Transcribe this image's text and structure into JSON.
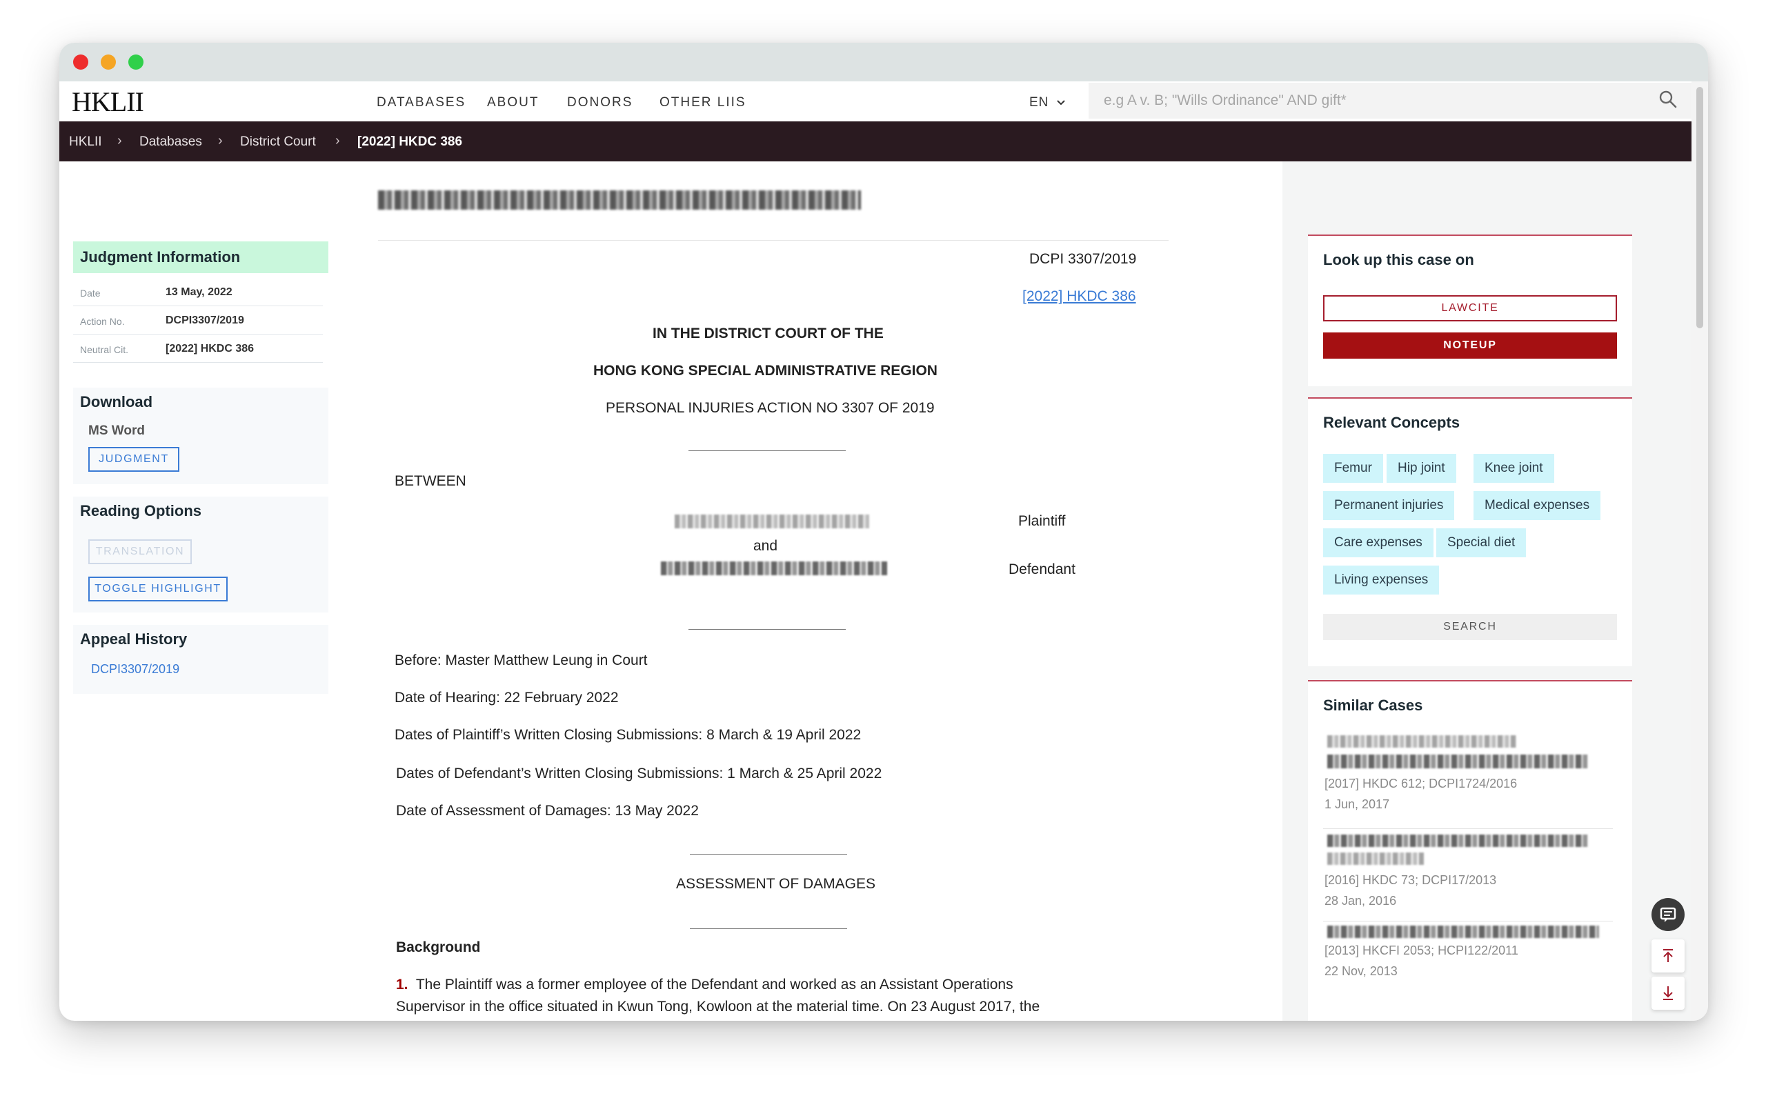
{
  "window": {
    "controls": [
      "close",
      "minimize",
      "zoom"
    ]
  },
  "nav": {
    "logo": "HKLII",
    "links": [
      "DATABASES",
      "ABOUT",
      "DONORS",
      "OTHER LIIS"
    ],
    "lang": "EN",
    "search_placeholder": "e.g A v. B; \"Wills Ordinance\" AND gift*",
    "search_icon": "search-icon"
  },
  "breadcrumb": [
    "HKLII",
    "Databases",
    "District Court",
    "[2022] HKDC 386"
  ],
  "breadcrumb_sep": "›",
  "sidebar": {
    "judgment_info": {
      "title": "Judgment Information",
      "rows": [
        {
          "key": "Date",
          "value": "13 May, 2022"
        },
        {
          "key": "Action No.",
          "value": "DCPI3307/2019"
        },
        {
          "key": "Neutral Cit.",
          "value": "[2022] HKDC 386"
        }
      ]
    },
    "download": {
      "title": "Download",
      "format": "MS Word",
      "button": "JUDGMENT"
    },
    "reading": {
      "title": "Reading Options",
      "translation": "TRANSLATION",
      "toggle": "TOGGLE HIGHLIGHT"
    },
    "appeal": {
      "title": "Appeal History",
      "link": "DCPI3307/2019"
    }
  },
  "doc": {
    "case_no": "DCPI 3307/2019",
    "citation_link": "[2022] HKDC 386",
    "court_line1": "IN THE DISTRICT COURT OF THE",
    "court_line2": "HONG KONG SPECIAL ADMINISTRATIVE REGION",
    "action_line": "PERSONAL INJURIES ACTION NO 3307 OF 2019",
    "between": "BETWEEN",
    "plaintiff_role": "Plaintiff",
    "and": "and",
    "defendant_role": "Defendant",
    "before": "Before: Master Matthew Leung in Court",
    "hearing": "Date of Hearing: 22 February 2022",
    "plaintiff_subs": "Dates of Plaintiff’s Written Closing Submissions: 8 March & 19 April 2022",
    "defendant_subs": "Dates of Defendant’s Written Closing Submissions: 1 March & 25 April 2022",
    "assessment_date": "Date of Assessment of Damages: 13 May 2022",
    "heading": "ASSESSMENT OF DAMAGES",
    "background": "Background",
    "para1_num": "1.",
    "para1_line1": "The Plaintiff was a former employee of the Defendant and worked as an Assistant Operations",
    "para1_line2": "Supervisor in the office situated in Kwun Tong, Kowloon at the material time. On 23 August 2017, the"
  },
  "right": {
    "lookup": {
      "title": "Look up this case on",
      "lawcite": "LAWCITE",
      "noteup": "NOTEUP"
    },
    "concepts": {
      "title": "Relevant Concepts",
      "chips": [
        "Femur",
        "Hip joint",
        "Knee joint",
        "Permanent injuries",
        "Medical expenses",
        "Care expenses",
        "Special diet",
        "Living expenses"
      ],
      "search": "SEARCH"
    },
    "similar": {
      "title": "Similar Cases",
      "items": [
        {
          "citation": "[2017] HKDC 612; DCPI1724/2016",
          "date": "1 Jun, 2017"
        },
        {
          "citation": "[2016] HKDC 73; DCPI17/2013",
          "date": "28 Jan, 2016"
        },
        {
          "citation": "[2013] HKCFI 2053; HCPI122/2011",
          "date": "22 Nov, 2013"
        }
      ]
    }
  },
  "floating": {
    "chat_icon": "chat-icon",
    "top_icon": "arrow-to-top-icon",
    "bottom_icon": "arrow-to-bottom-icon"
  },
  "colors": {
    "accent_blue": "#3a7bd5",
    "noteup_red": "#a51012",
    "breadcrumb_bg": "#2a1a20",
    "judgment_header_bg": "#c9f7dc",
    "chip_bg": "#cff5fb",
    "card_border": "#c24a5e"
  }
}
